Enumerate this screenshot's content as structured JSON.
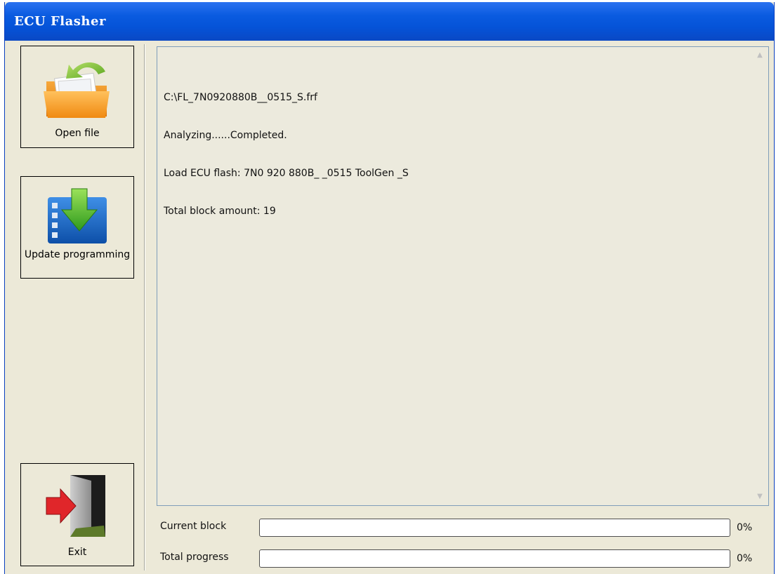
{
  "window": {
    "title": "ECU Flasher"
  },
  "sidebar": {
    "open_file": {
      "label": "Open file",
      "icon": "open-folder-icon"
    },
    "update_programming": {
      "label": "Update programming",
      "icon": "update-download-icon"
    },
    "exit": {
      "label": "Exit",
      "icon": "exit-door-icon"
    }
  },
  "log": {
    "lines": [
      "C:\\FL_7N0920880B__0515_S.frf",
      "Analyzing......Completed.",
      "Load ECU flash: 7N0 920 880B_ _0515 ToolGen _S",
      "Total block amount: 19"
    ]
  },
  "progress": {
    "current_block": {
      "label": "Current block",
      "percent_text": "0%",
      "value": 0
    },
    "total_progress": {
      "label": "Total progress",
      "percent_text": "0%",
      "value": 0
    }
  },
  "colors": {
    "titlebar": "#0553d8",
    "window_bg": "#ece9d8",
    "progress_fill": "#3cb44a"
  }
}
